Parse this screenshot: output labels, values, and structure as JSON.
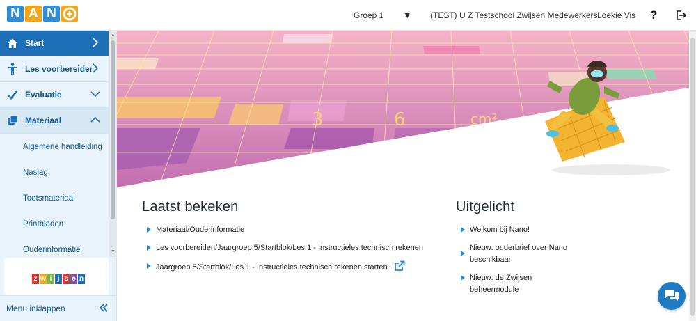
{
  "header": {
    "logo_letters": [
      "N",
      "A",
      "N",
      "O"
    ],
    "logo_colors": [
      "#2f8fd6",
      "#f2a71b",
      "#2f8fd6",
      "#f2a71b"
    ],
    "group_select": "Groep 1",
    "school": "(TEST) U Z Testschool Zwijsen Medewerkers",
    "user": "Loekie Vis",
    "help": "?"
  },
  "sidebar": {
    "items": [
      {
        "label": "Start",
        "icon": "home-icon",
        "active": true
      },
      {
        "label": "Les voorbereiden",
        "icon": "person-icon"
      },
      {
        "label": "Evaluatie",
        "icon": "check-icon"
      },
      {
        "label": "Materiaal",
        "icon": "copies-icon",
        "open": true
      }
    ],
    "sub_items": [
      "Algemene handleiding",
      "Naslag",
      "Toetsmateriaal",
      "Printbladen",
      "Ouderinformatie"
    ],
    "brand": "zwijsen",
    "collapse_label": "Menu inklappen"
  },
  "hero": {
    "tile_labels": [
      "3",
      "6",
      "cm²"
    ]
  },
  "recent": {
    "title": "Laatst bekeken",
    "items": [
      "Materiaal/Ouderinformatie",
      "Les voorbereiden/Jaargroep 5/Startblok/Les 1 - Instructieles technisch rekenen",
      "Jaargroep 5/Startblok/Les 1 - Instructieles technisch rekenen starten"
    ]
  },
  "featured": {
    "title": "Uitgelicht",
    "items": [
      "Welkom bij Nano!",
      "Nieuw: ouderbrief over Nano beschikbaar",
      "Nieuw: de Zwijsen beheermodule"
    ]
  },
  "colors": {
    "primary": "#1d6fb8",
    "sidebar_bg": "#e9f3fb",
    "accent": "#2489d6"
  }
}
